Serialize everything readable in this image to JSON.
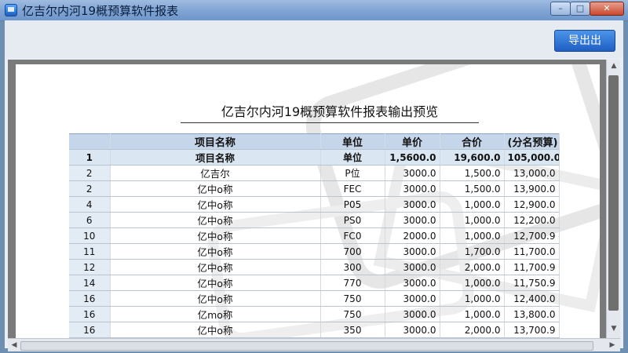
{
  "window": {
    "title": "亿吉尔内河19概预算软件报表",
    "icon": "app-icon",
    "controls": {
      "minimize": "–",
      "maximize": "□",
      "close": "✕"
    }
  },
  "toolbar": {
    "export_label": "导出出"
  },
  "report": {
    "title": "亿吉尔内河19概预算软件报表输出预览",
    "headers": [
      "",
      "项目名称",
      "单位",
      "单价",
      "合价",
      "(分名预算)"
    ],
    "first_row": [
      "1",
      "项目名称",
      "单位",
      "1,5600.0",
      "19,600.0",
      "105,000.0"
    ],
    "rows": [
      [
        "2",
        "亿吉尔",
        "P位",
        "3000.0",
        "1,500.0",
        "13,000.0"
      ],
      [
        "2",
        "亿中o称",
        "FEC",
        "3000.0",
        "1,500.0",
        "13,900.0"
      ],
      [
        "4",
        "亿中o称",
        "P05",
        "3000.0",
        "1,000.0",
        "12,900.0"
      ],
      [
        "6",
        "亿中o称",
        "PS0",
        "3000.0",
        "1,000.0",
        "12,200.0"
      ],
      [
        "10",
        "亿中o称",
        "FC0",
        "2000.0",
        "1,000.0",
        "12,700.9"
      ],
      [
        "11",
        "亿中o称",
        "700",
        "3000.0",
        "1,700.0",
        "11,700.0"
      ],
      [
        "12",
        "亿中o称",
        "300",
        "3000.0",
        "2,000.0",
        "11,700.9"
      ],
      [
        "14",
        "亿中o称",
        "770",
        "3000.0",
        "1,000.0",
        "11,750.9"
      ],
      [
        "16",
        "亿中o称",
        "750",
        "3000.0",
        "1,000.0",
        "12,400.0"
      ],
      [
        "16",
        "亿mo称",
        "750",
        "3000.0",
        "1,000.0",
        "13,800.0"
      ],
      [
        "16",
        "亿中o称",
        "350",
        "3000.0",
        "2,000.0",
        "13,700.9"
      ]
    ]
  },
  "scrollbars": {
    "up": "▲",
    "down": "▼",
    "left": "◀",
    "right": "▶"
  }
}
